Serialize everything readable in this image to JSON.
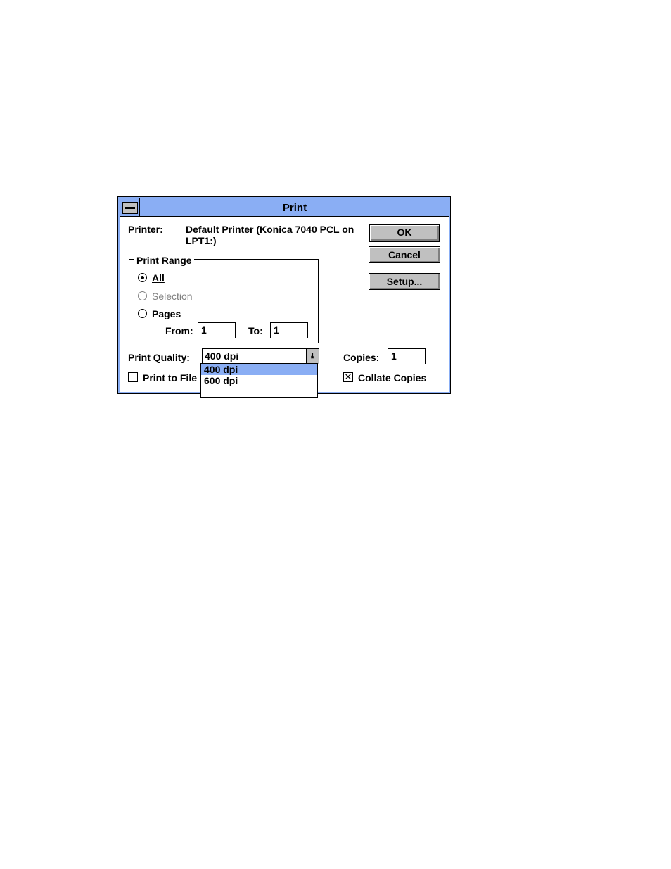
{
  "dialog": {
    "title": "Print",
    "printer_label": "Printer:",
    "printer_value": "Default Printer (Konica 7040 PCL on LPT1:)",
    "buttons": {
      "ok": "OK",
      "cancel": "Cancel",
      "setup": "Setup..."
    },
    "print_range": {
      "label": "Print Range",
      "options": [
        {
          "label": "All",
          "selected": true,
          "enabled": true
        },
        {
          "label": "Selection",
          "selected": false,
          "enabled": false
        },
        {
          "label": "Pages",
          "selected": false,
          "enabled": true
        }
      ],
      "from_label": "From:",
      "from_value": "1",
      "to_label": "To:",
      "to_value": "1"
    },
    "print_quality": {
      "label": "Print Quality:",
      "value": "400 dpi",
      "options": [
        "400 dpi",
        "600 dpi"
      ],
      "highlighted": "400 dpi"
    },
    "copies": {
      "label": "Copies:",
      "value": "1"
    },
    "print_to_file": {
      "label": "Print to File",
      "checked": false
    },
    "collate_copies": {
      "label": "Collate Copies",
      "checked": true
    }
  },
  "colors": {
    "titlebar": "#8aaef4",
    "selection": "#8aaef4",
    "button_face": "#c0c0c0"
  }
}
